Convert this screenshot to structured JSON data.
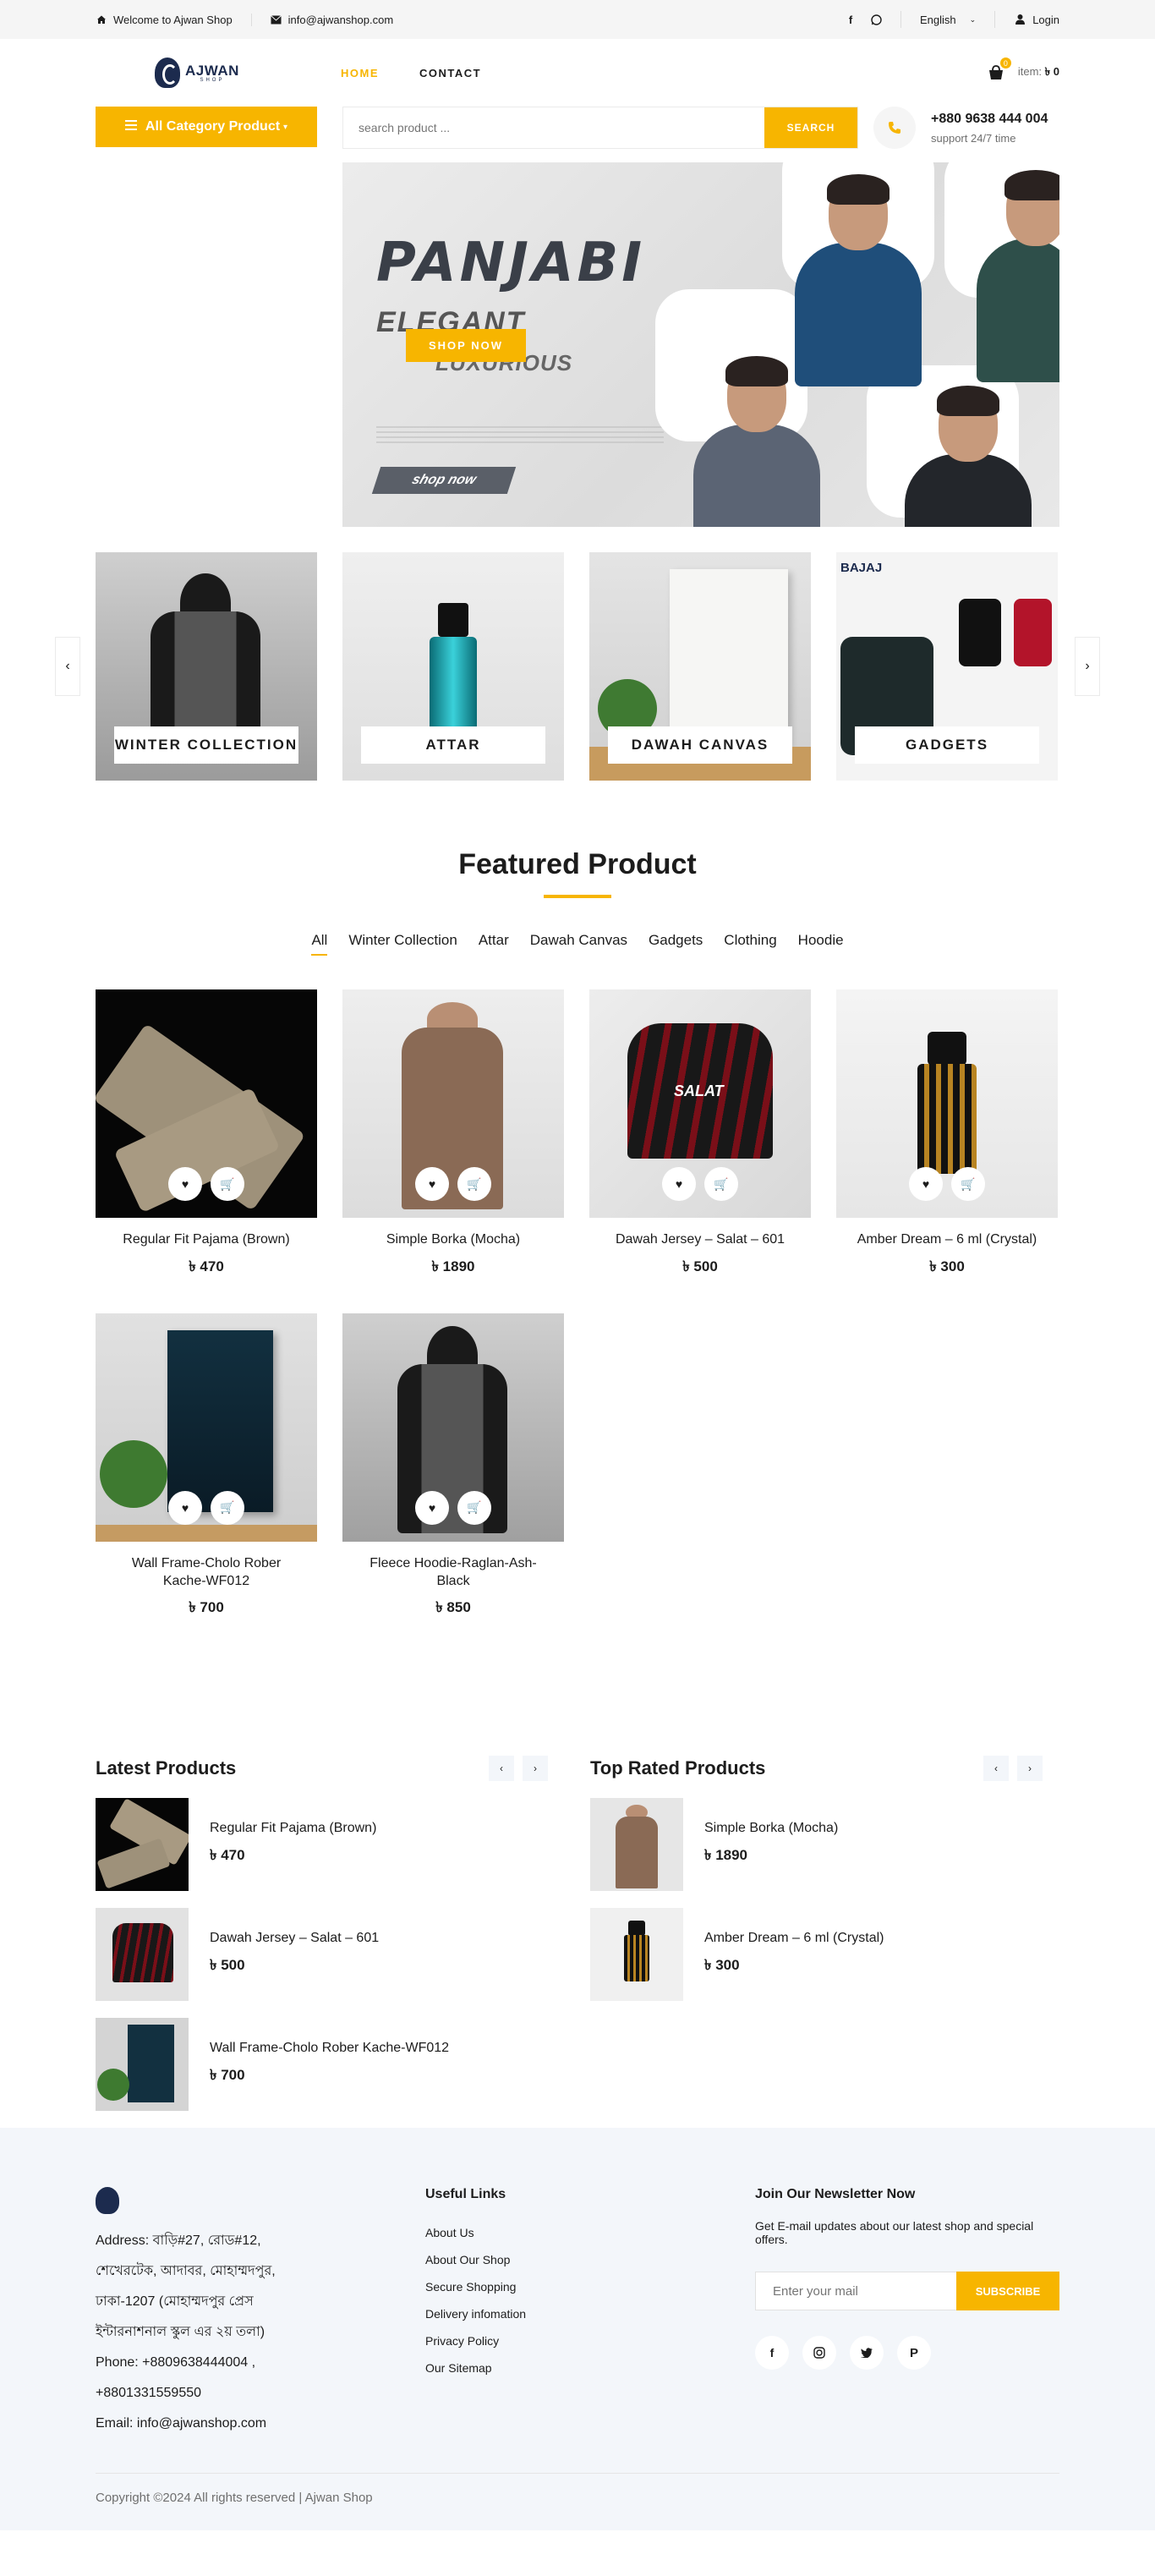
{
  "topbar": {
    "welcome": "Welcome to Ajwan Shop",
    "email": "info@ajwanshop.com",
    "language": "English",
    "login": "Login"
  },
  "header": {
    "logo_text": "AJWAN",
    "logo_sub": "SHOP",
    "nav": [
      {
        "label": "HOME",
        "active": true
      },
      {
        "label": "CONTACT",
        "active": false
      }
    ],
    "cart_count": "0",
    "cart_label": "item:",
    "cart_total": "৳ 0"
  },
  "hero": {
    "department_label": "All Category Product",
    "search_placeholder": "search product ...",
    "search_button": "SEARCH",
    "phone": "+880 9638 444 004",
    "support": "support 24/7 time",
    "banner": {
      "title": "PANJABI",
      "line1": "ELEGANT",
      "line2": "LUXURIOUS",
      "cta": "SHOP NOW",
      "pill": "shop now"
    }
  },
  "categories": [
    {
      "label": "WINTER COLLECTION"
    },
    {
      "label": "ATTAR"
    },
    {
      "label": "DAWAH CANVAS"
    },
    {
      "label": "GADGETS"
    }
  ],
  "featured": {
    "title": "Featured Product",
    "filters": [
      "All",
      "Winter Collection",
      "Attar",
      "Dawah Canvas",
      "Gadgets",
      "Clothing",
      "Hoodie"
    ],
    "products": [
      {
        "name": "Regular Fit Pajama (Brown)",
        "price": "৳ 470"
      },
      {
        "name": "Simple Borka (Mocha)",
        "price": "৳ 1890"
      },
      {
        "name": "Dawah Jersey – Salat – 601",
        "price": "৳ 500"
      },
      {
        "name": "Amber Dream – 6 ml (Crystal)",
        "price": "৳ 300"
      },
      {
        "name": "Wall Frame-Cholo Rober Kache-WF012",
        "price": "৳ 700"
      },
      {
        "name": "Fleece Hoodie-Raglan-Ash-Black",
        "price": "৳ 850"
      }
    ]
  },
  "latest": {
    "title": "Latest Products",
    "items": [
      {
        "name": "Regular Fit Pajama (Brown)",
        "price": "৳ 470"
      },
      {
        "name": "Dawah Jersey – Salat – 601",
        "price": "৳ 500"
      },
      {
        "name": "Wall Frame-Cholo Rober Kache-WF012",
        "price": "৳ 700"
      }
    ]
  },
  "top_rated": {
    "title": "Top Rated Products",
    "items": [
      {
        "name": "Simple Borka (Mocha)",
        "price": "৳ 1890"
      },
      {
        "name": "Amber Dream – 6 ml (Crystal)",
        "price": "৳ 300"
      }
    ]
  },
  "footer": {
    "address_lines": [
      "Address: বাড়ি#27, রোড#12,",
      "শেখেরটেক, আদাবর, মোহাম্মদপুর,",
      "ঢাকা-1207 (মোহাম্মদপুর প্রেস",
      "ইন্টারনাশনাল স্কুল এর ২য় তলা)",
      "Phone: +8809638444004 ,",
      "+8801331559550",
      "Email: info@ajwanshop.com"
    ],
    "links_title": "Useful Links",
    "links": [
      "About Us",
      "About Our Shop",
      "Secure Shopping",
      "Delivery infomation",
      "Privacy Policy",
      "Our Sitemap"
    ],
    "newsletter_title": "Join Our Newsletter Now",
    "newsletter_text": "Get E-mail updates about our latest shop and special offers.",
    "newsletter_placeholder": "Enter your mail",
    "newsletter_button": "SUBSCRIBE",
    "copyright": "Copyright ©2024 All rights reserved | Ajwan Shop"
  },
  "colors": {
    "accent": "#f7b500",
    "footer_bg": "#f3f6fa",
    "topbar_bg": "#f5f5f5"
  }
}
